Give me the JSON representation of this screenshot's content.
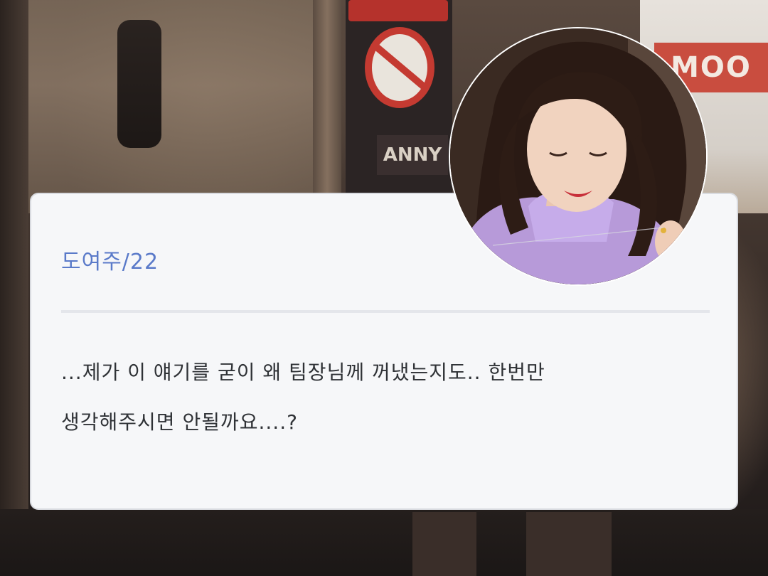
{
  "background": {
    "sign_text": "ANNY",
    "right_sign_text": "MOO"
  },
  "card": {
    "name": "도여주/22",
    "message_lines": [
      "...제가 이 얘기를 굳이 왜 팀장님께 꺼냈는지도.. 한번만",
      "생각해주시면 안될까요....?"
    ]
  },
  "avatar": {
    "icon": "profile-photo"
  },
  "colors": {
    "card_background": "#f6f7f9",
    "name_color": "#5a7ac9",
    "text_color": "#2f3236",
    "divider": "#e4e6eb"
  }
}
